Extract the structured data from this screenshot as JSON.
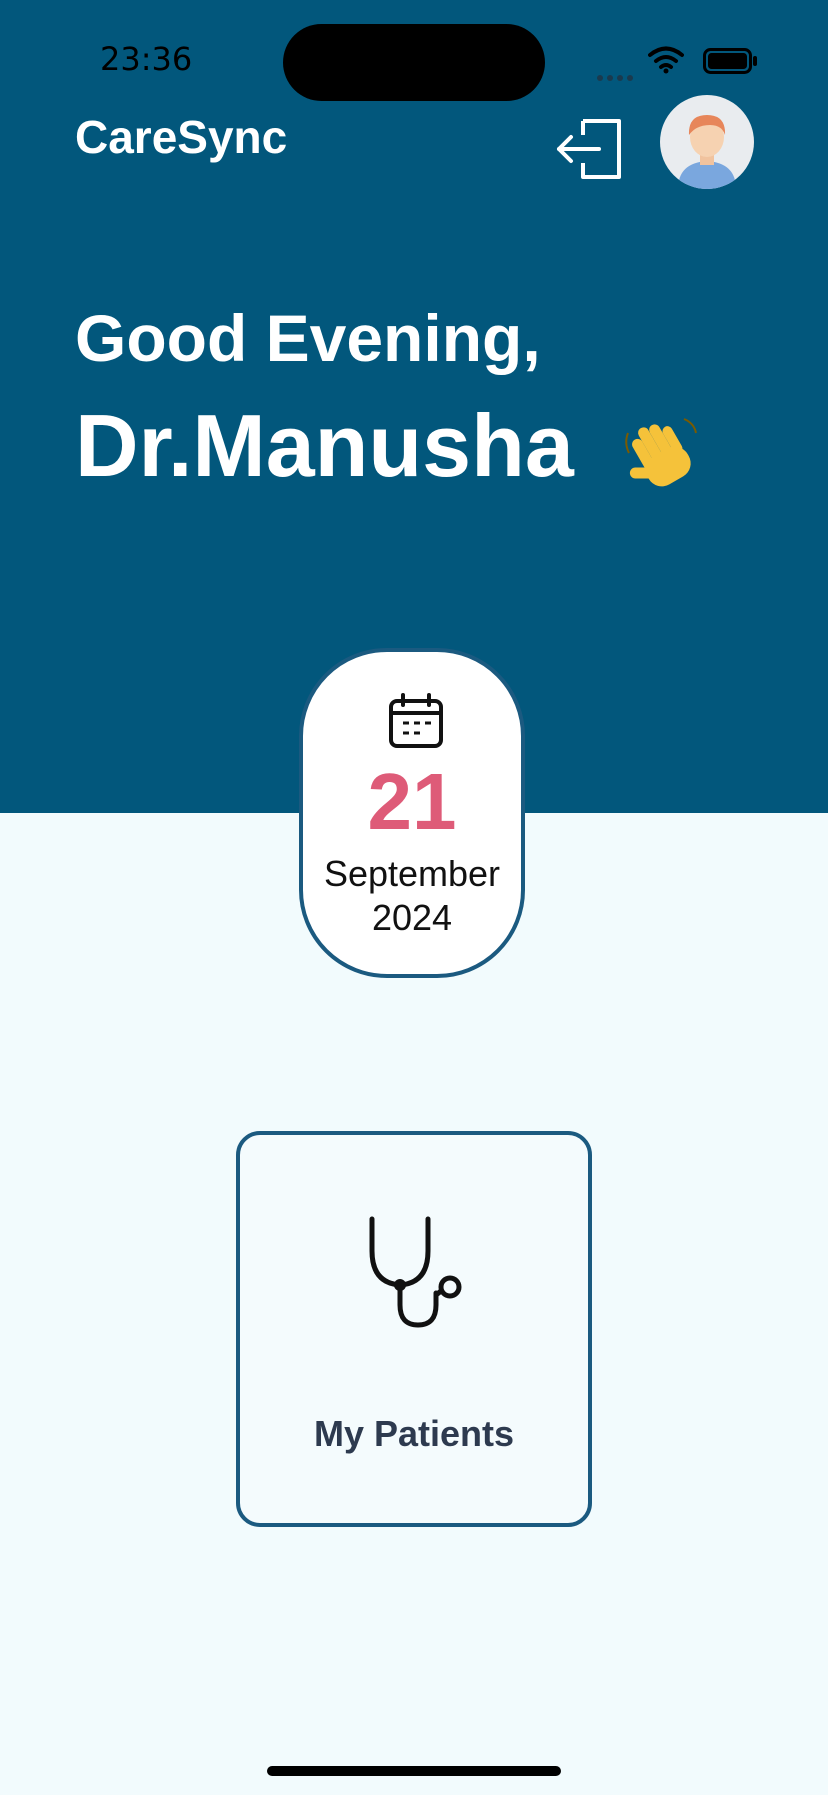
{
  "status_bar": {
    "time": "23:36"
  },
  "header": {
    "app_title": "CareSync",
    "greeting": "Good Evening,",
    "doctor_name": "Dr.Manusha",
    "wave_emoji": "👋"
  },
  "date_card": {
    "day": "21",
    "month": "September",
    "year": "2024"
  },
  "patients_card": {
    "label": "My Patients"
  },
  "colors": {
    "header_bg": "#02577c",
    "page_bg": "#f2fbfd",
    "accent_border": "#1b5a80",
    "date_day": "#de5b78",
    "label_text": "#2d3a4f"
  },
  "icons": [
    "logout-icon",
    "avatar",
    "calendar-icon",
    "stethoscope-icon",
    "wifi-icon",
    "battery-icon"
  ]
}
